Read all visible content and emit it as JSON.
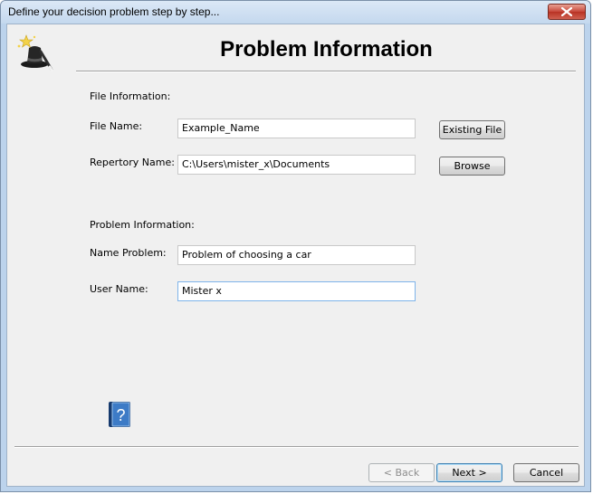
{
  "window": {
    "title": "Define your decision problem step by step..."
  },
  "header": {
    "title": "Problem Information"
  },
  "file_section": {
    "heading": "File Information:",
    "file_name_label": "File Name:",
    "file_name_value": "Example_Name",
    "existing_file_button": "Existing File",
    "repertory_label": "Repertory Name:",
    "repertory_value": "C:\\Users\\mister_x\\Documents",
    "browse_button": "Browse"
  },
  "problem_section": {
    "heading": "Problem Information:",
    "name_problem_label": "Name Problem:",
    "name_problem_value": "Problem of choosing a car",
    "user_name_label": "User Name:",
    "user_name_value": "Mister x"
  },
  "footer": {
    "back_button": "< Back",
    "next_button": "Next >",
    "cancel_button": "Cancel"
  },
  "icons": [
    "wizard-hat-icon",
    "close-icon",
    "help-book-icon"
  ],
  "colors": {
    "title_bar": "#c4d8ee",
    "close_button": "#c7473a",
    "focus_border": "#7eb4ea"
  }
}
